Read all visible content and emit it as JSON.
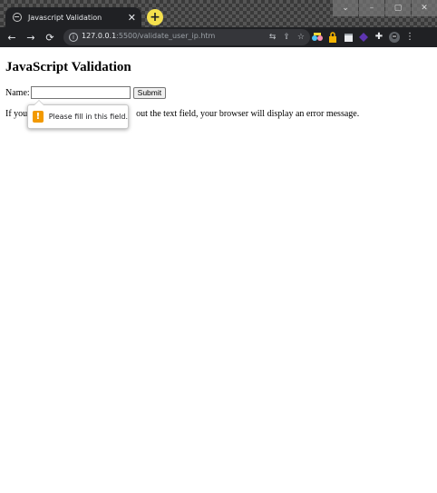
{
  "browser": {
    "tab": {
      "title": "Javascript Validation",
      "close_glyph": "✕",
      "favicon": "globe-icon"
    },
    "new_tab_glyph": "+",
    "window_controls": [
      "⌄",
      "–",
      "▢",
      "✕"
    ],
    "nav": {
      "back": "←",
      "forward": "→",
      "reload": "⟳"
    },
    "address": {
      "host": "127.0.0.1",
      "rest": ":5500/validate_user_ip.htm",
      "info_glyph": "i"
    },
    "omnibox_icons": [
      "translate-icon",
      "share-icon",
      "bookmark-star-icon"
    ],
    "extensions": [
      "extension-colorful-icon",
      "extension-lock-icon",
      "extension-box-icon",
      "extension-purple-icon",
      "puzzle-icon",
      "avatar-icon",
      "menu-icon"
    ],
    "colors": {
      "frame": "#202124",
      "new_tab": "#f4e04d",
      "warning": "#f29900"
    }
  },
  "page": {
    "heading": "JavaScript Validation",
    "form": {
      "label": "Name:",
      "input_value": "",
      "submit_label": "Submit"
    },
    "paragraph_start": "If you",
    "paragraph_end": "out the text field, your browser will display an error message.",
    "tooltip": {
      "icon_glyph": "!",
      "message": "Please fill in this field."
    }
  }
}
